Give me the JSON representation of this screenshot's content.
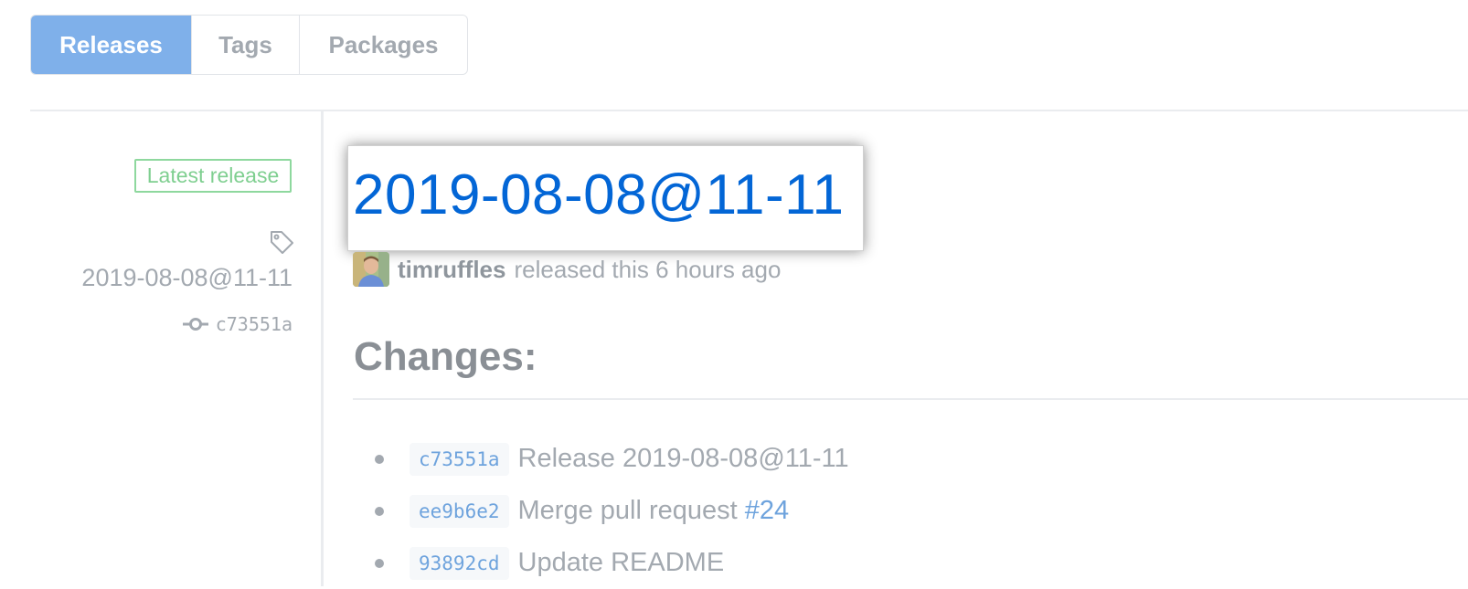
{
  "tabs": [
    {
      "label": "Releases",
      "active": true
    },
    {
      "label": "Tags",
      "active": false
    },
    {
      "label": "Packages",
      "active": false
    }
  ],
  "sidebar": {
    "badge": "Latest release",
    "tag_icon": "tag-icon",
    "tag_name": "2019-08-08@11-11",
    "commit_icon": "git-commit-icon",
    "commit_sha": "c73551a"
  },
  "release": {
    "title": "2019-08-08@11-11",
    "author": "timruffles",
    "meta_text": "released this 6 hours ago",
    "changes_heading": "Changes:",
    "changes": [
      {
        "sha": "c73551a",
        "message": "Release 2019-08-08@11-11",
        "link": ""
      },
      {
        "sha": "ee9b6e2",
        "message": "Merge pull request",
        "link": "#24"
      },
      {
        "sha": "93892cd",
        "message": "Update README",
        "link": ""
      }
    ]
  },
  "colors": {
    "accent": "#0366d6",
    "active_tab": "#7fb0ea",
    "badge_green": "#7fcf90",
    "link": "#6ea3dd"
  }
}
